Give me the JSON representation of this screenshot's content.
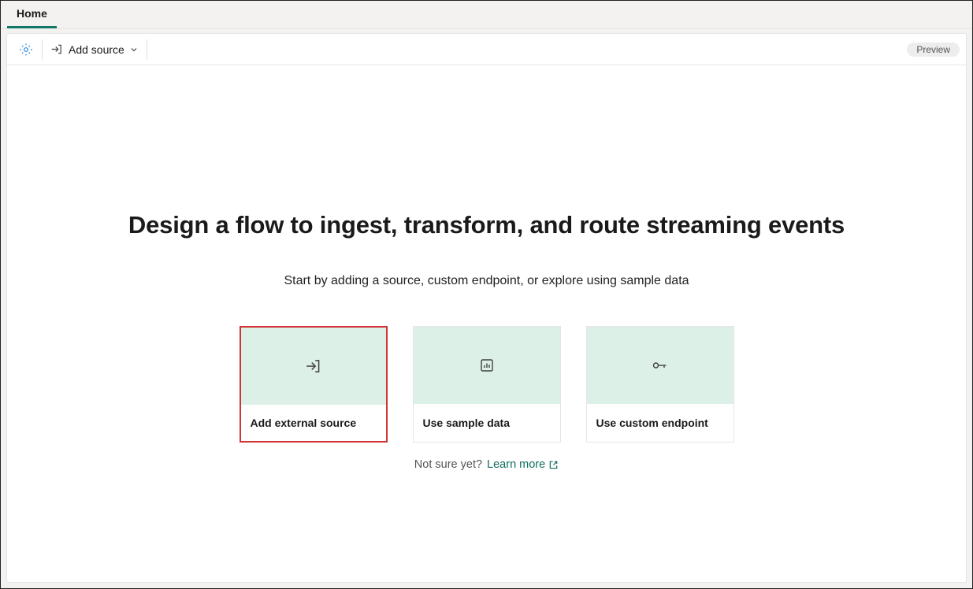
{
  "tabs": {
    "home": "Home"
  },
  "toolbar": {
    "addSource": "Add source",
    "previewBadge": "Preview"
  },
  "main": {
    "title": "Design a flow to ingest, transform, and route streaming events",
    "subtitle": "Start by adding a source, custom endpoint, or explore using sample data",
    "cards": [
      {
        "label": "Add external source"
      },
      {
        "label": "Use sample data"
      },
      {
        "label": "Use custom endpoint"
      }
    ],
    "hint": {
      "question": "Not sure yet?",
      "link": "Learn more"
    }
  },
  "colors": {
    "accent": "#117865",
    "highlight": "#d13438",
    "cardTop": "#dcf0e8"
  }
}
